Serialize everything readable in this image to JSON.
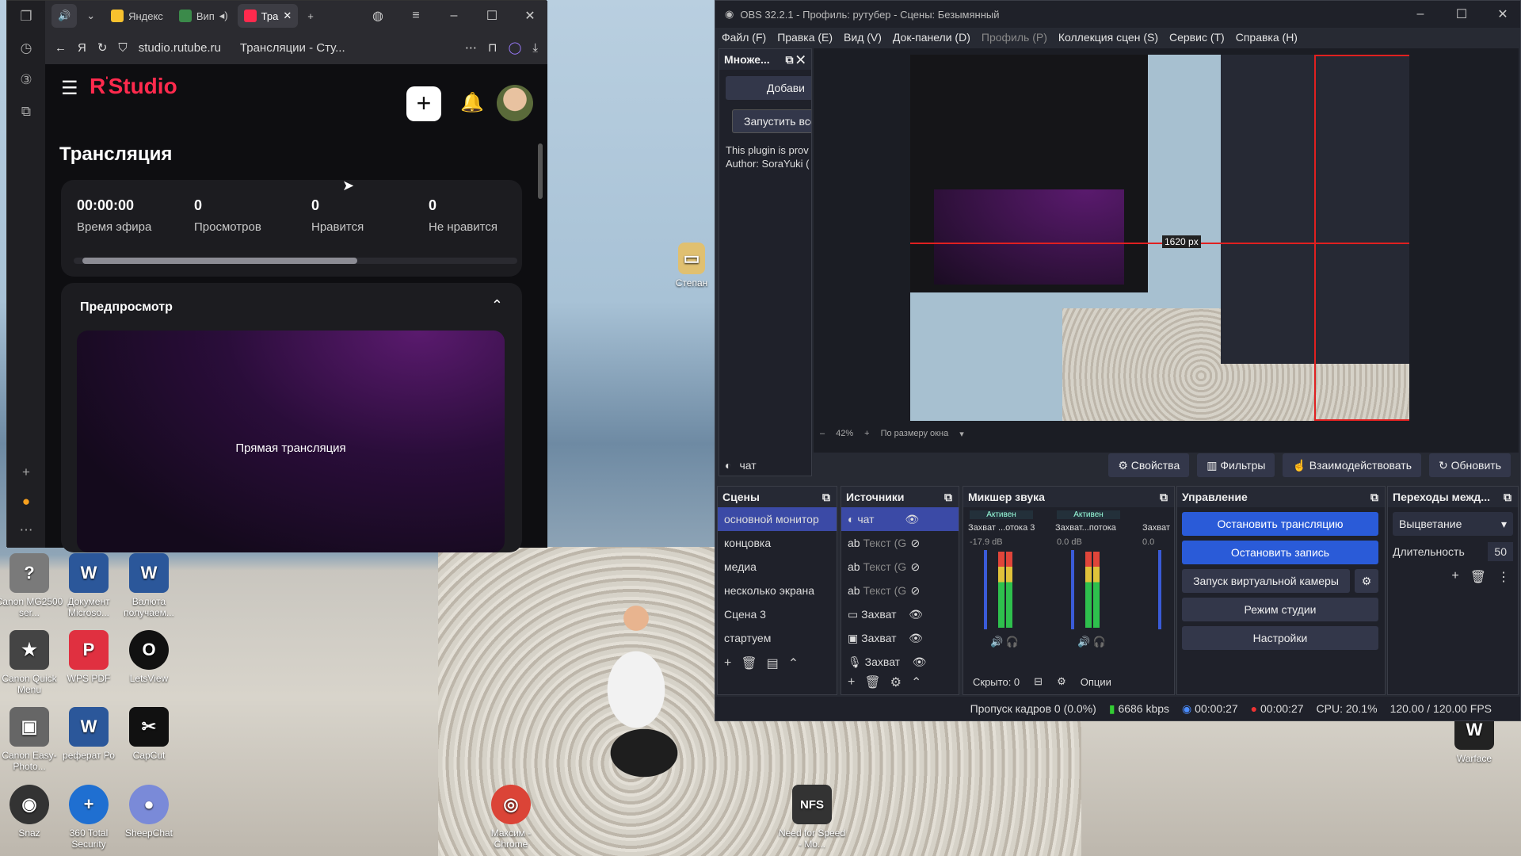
{
  "browser": {
    "tabs": [
      {
        "label": "Яндекс"
      },
      {
        "label": "Вип"
      },
      {
        "label": "Тра"
      }
    ],
    "url": "studio.rutube.ru",
    "page_title": "Трансляции - Сту..."
  },
  "rutube": {
    "logo": "Studio",
    "section": "Трансляция",
    "stats": [
      {
        "value": "00:00:00",
        "label": "Время эфира"
      },
      {
        "value": "0",
        "label": "Просмотров"
      },
      {
        "value": "0",
        "label": "Нравится"
      },
      {
        "value": "0",
        "label": "Не нравится"
      }
    ],
    "preview_title": "Предпросмотр",
    "preview_text": "Прямая трансляция"
  },
  "desktop": {
    "icons": [
      {
        "label": "Canon MG2500 ser...",
        "glyph": "?",
        "color": "#7a7a7a"
      },
      {
        "label": "Документ Microso...",
        "glyph": "W",
        "color": "#2b579a"
      },
      {
        "label": "Валюта получаем...",
        "glyph": "W",
        "color": "#2b579a"
      },
      {
        "label": "Canon Quick Menu",
        "glyph": "★",
        "color": "#444"
      },
      {
        "label": "WPS PDF",
        "glyph": "P",
        "color": "#e03040"
      },
      {
        "label": "LetsView",
        "glyph": "O",
        "color": "#111"
      },
      {
        "label": "Canon Easy-Photo...",
        "glyph": "▣",
        "color": "#666"
      },
      {
        "label": "реферат Ро",
        "glyph": "W",
        "color": "#2b579a"
      },
      {
        "label": "CapCut",
        "glyph": "✂",
        "color": "#111"
      },
      {
        "label": "Snaz",
        "glyph": "◉",
        "color": "#333"
      },
      {
        "label": "360 Total Security",
        "glyph": "+",
        "color": "#1f6fd1"
      },
      {
        "label": "SheepChat",
        "glyph": "●",
        "color": "#7a8ad8"
      },
      {
        "label": "Степан",
        "glyph": "▭",
        "color": "#e0c070"
      },
      {
        "label": "Максим - Chrome",
        "glyph": "◎",
        "color": "#db4437"
      },
      {
        "label": "Need for Speed - Mo...",
        "glyph": "NFS",
        "color": "#333"
      },
      {
        "label": "Warface",
        "glyph": "W",
        "color": "#222"
      }
    ]
  },
  "obs": {
    "title": "OBS 32.2.1 - Профиль: рутубер - Сцены: Безымянный",
    "menu": [
      "Файл (F)",
      "Правка (E)",
      "Вид (V)",
      "Док-панели (D)",
      "Профиль (P)",
      "Коллекция сцен (S)",
      "Сервис (T)",
      "Справка (H)"
    ],
    "plugin": {
      "title": "Множе...",
      "add": "Добави",
      "start_all": "Запустить все",
      "text": "This plugin is prov",
      "author": "Author: SoraYuki ("
    },
    "preview": {
      "measure": "1620 px",
      "zoom": "42%",
      "fit": "По размеру окна"
    },
    "source_bar": {
      "name": "чат",
      "props": "Свойства",
      "filters": "Фильтры",
      "interact": "Взаимодействовать",
      "refresh": "Обновить"
    },
    "scenes": {
      "title": "Сцены",
      "items": [
        "основной монитор",
        "концовка",
        "медиа",
        "несколько экрана",
        "Сцена 3",
        "стартуем"
      ]
    },
    "sources": {
      "title": "Источники",
      "items": [
        "чат",
        "Текст (G",
        "Текст (G",
        "Текст (G",
        "Захват",
        "Захват",
        "Захват"
      ]
    },
    "mixer": {
      "title": "Микшер звука",
      "ch1": {
        "active": "Активен",
        "name": "Захват ...отока 3",
        "db": "-17.9 dB"
      },
      "ch2": {
        "active": "Активен",
        "name": "Захват...потока",
        "db": "0.0 dB"
      },
      "ch3": {
        "name": "Захват",
        "db": "0.0"
      },
      "hidden": "Скрыто: 0",
      "options": "Опции"
    },
    "controls": {
      "title": "Управление",
      "stop_stream": "Остановить трансляцию",
      "stop_rec": "Остановить запись",
      "virtual_cam": "Запуск виртуальной камеры",
      "studio": "Режим студии",
      "settings": "Настройки"
    },
    "transitions": {
      "title": "Переходы межд...",
      "type": "Выцветание",
      "dur_label": "Длительность",
      "dur": "50"
    },
    "status": {
      "dropped": "Пропуск кадров 0 (0.0%)",
      "kbps": "6686 kbps",
      "stream_time": "00:00:27",
      "rec_time": "00:00:27",
      "cpu": "CPU: 20.1%",
      "fps": "120.00 / 120.00 FPS"
    }
  },
  "colors": {
    "accent": "#2a5bd8",
    "rutube": "#ff2a4d"
  }
}
